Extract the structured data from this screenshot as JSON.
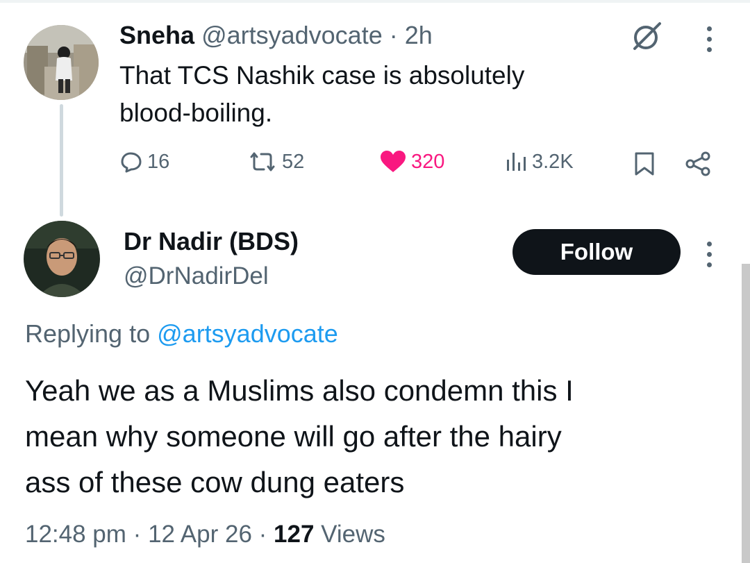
{
  "parent_tweet": {
    "author_name": "Sneha",
    "handle": "@artsyadvocate",
    "separator": "·",
    "time_ago": "2h",
    "text_line1": "That TCS Nashik case is absolutely",
    "text_line2": "blood-boiling.",
    "stats": {
      "replies": "16",
      "reposts": "52",
      "likes": "320",
      "views": "3.2K"
    },
    "like_color": "#f91880"
  },
  "reply_tweet": {
    "author_name": "Dr Nadir (BDS)",
    "handle": "@DrNadirDel",
    "follow_label": "Follow",
    "replying_prefix": "Replying to",
    "replying_handle": "@artsyadvocate",
    "text_line1": "Yeah we as a Muslims also condemn this I",
    "text_line2": "mean why someone will go after the hairy",
    "text_line3": "ass of these cow dung eaters",
    "time": "12:48 pm",
    "date": "12 Apr 26",
    "views_count": "127",
    "views_label": "Views",
    "separator": "·"
  },
  "colors": {
    "link": "#1d9bf0",
    "muted": "#536471",
    "text": "#0f1419"
  }
}
